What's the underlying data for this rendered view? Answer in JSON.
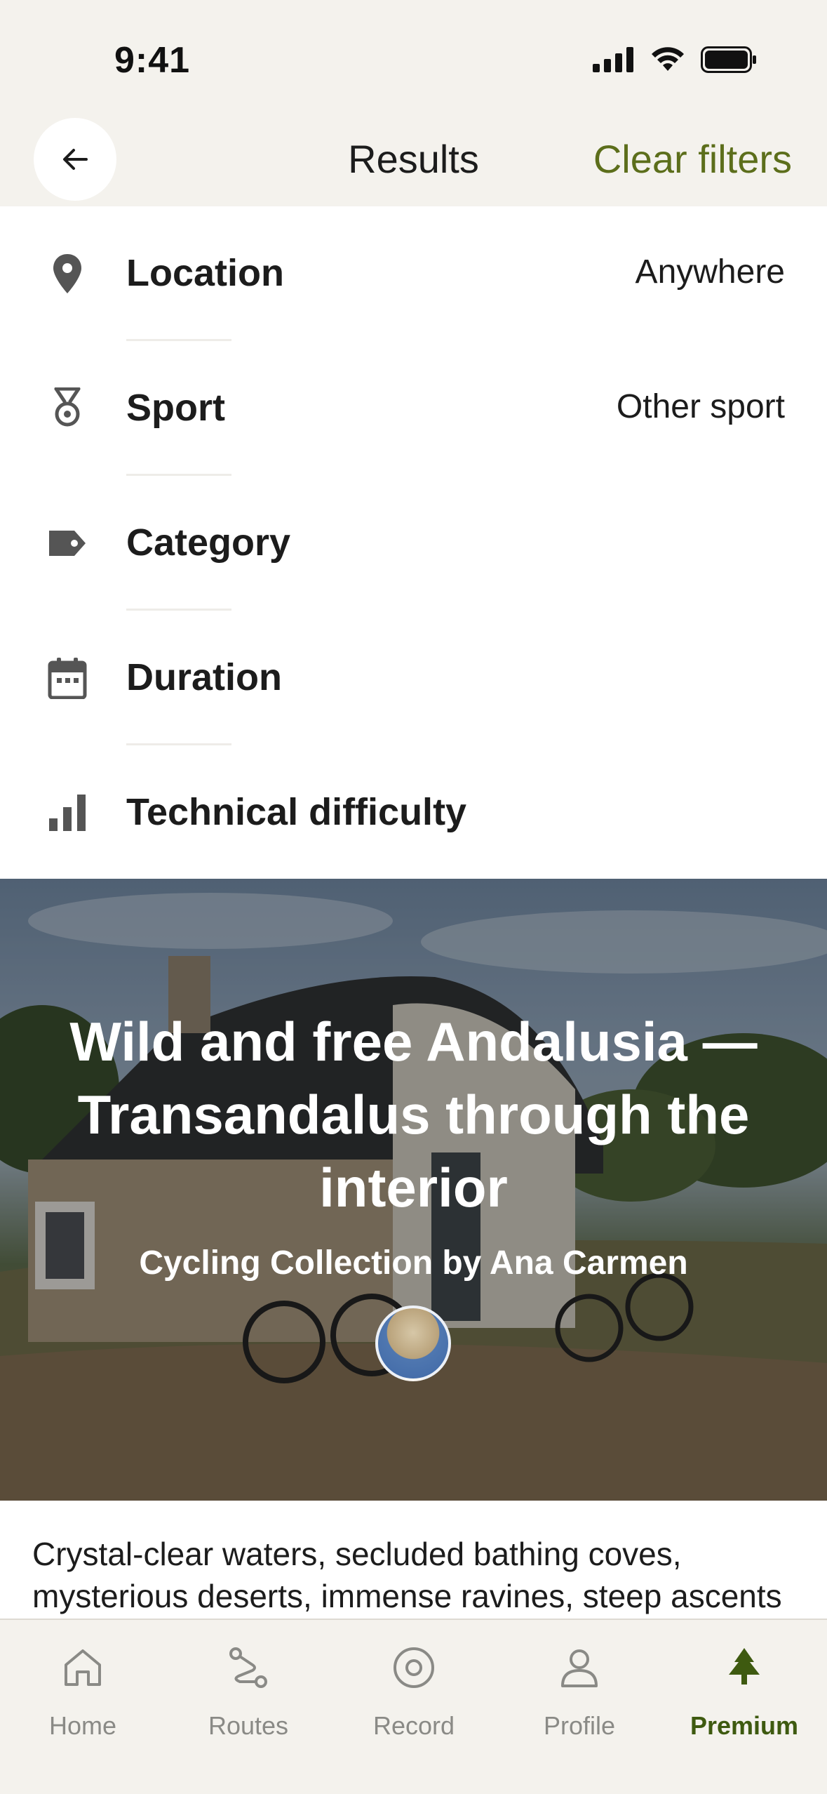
{
  "status_bar": {
    "time": "9:41"
  },
  "header": {
    "title": "Results",
    "clear_filters": "Clear filters"
  },
  "filters": [
    {
      "label": "Location",
      "value": "Anywhere",
      "icon": "location-pin-icon"
    },
    {
      "label": "Sport",
      "value": "Other sport",
      "icon": "medal-icon"
    },
    {
      "label": "Category",
      "value": "",
      "icon": "tag-icon"
    },
    {
      "label": "Duration",
      "value": "",
      "icon": "calendar-icon"
    },
    {
      "label": "Technical difficulty",
      "value": "",
      "icon": "difficulty-bars-icon"
    }
  ],
  "collection": {
    "title": "Wild and free Andalusia — Transandalus through the interior",
    "subtitle": "Cycling Collection by Ana Carmen",
    "description": "Crystal-clear waters, secluded bathing coves, mysterious deserts, immense ravines, steep ascents"
  },
  "tab_bar": {
    "items": [
      {
        "label": "Home",
        "icon": "home-icon",
        "active": false
      },
      {
        "label": "Routes",
        "icon": "routes-icon",
        "active": false
      },
      {
        "label": "Record",
        "icon": "record-icon",
        "active": false
      },
      {
        "label": "Profile",
        "icon": "profile-icon",
        "active": false
      },
      {
        "label": "Premium",
        "icon": "tree-icon",
        "active": true
      }
    ]
  },
  "colors": {
    "accent": "#5c6e1b",
    "premium_active": "#3e5a10",
    "background": "#f4f2ed",
    "icon_gray": "#5a5a5a"
  }
}
